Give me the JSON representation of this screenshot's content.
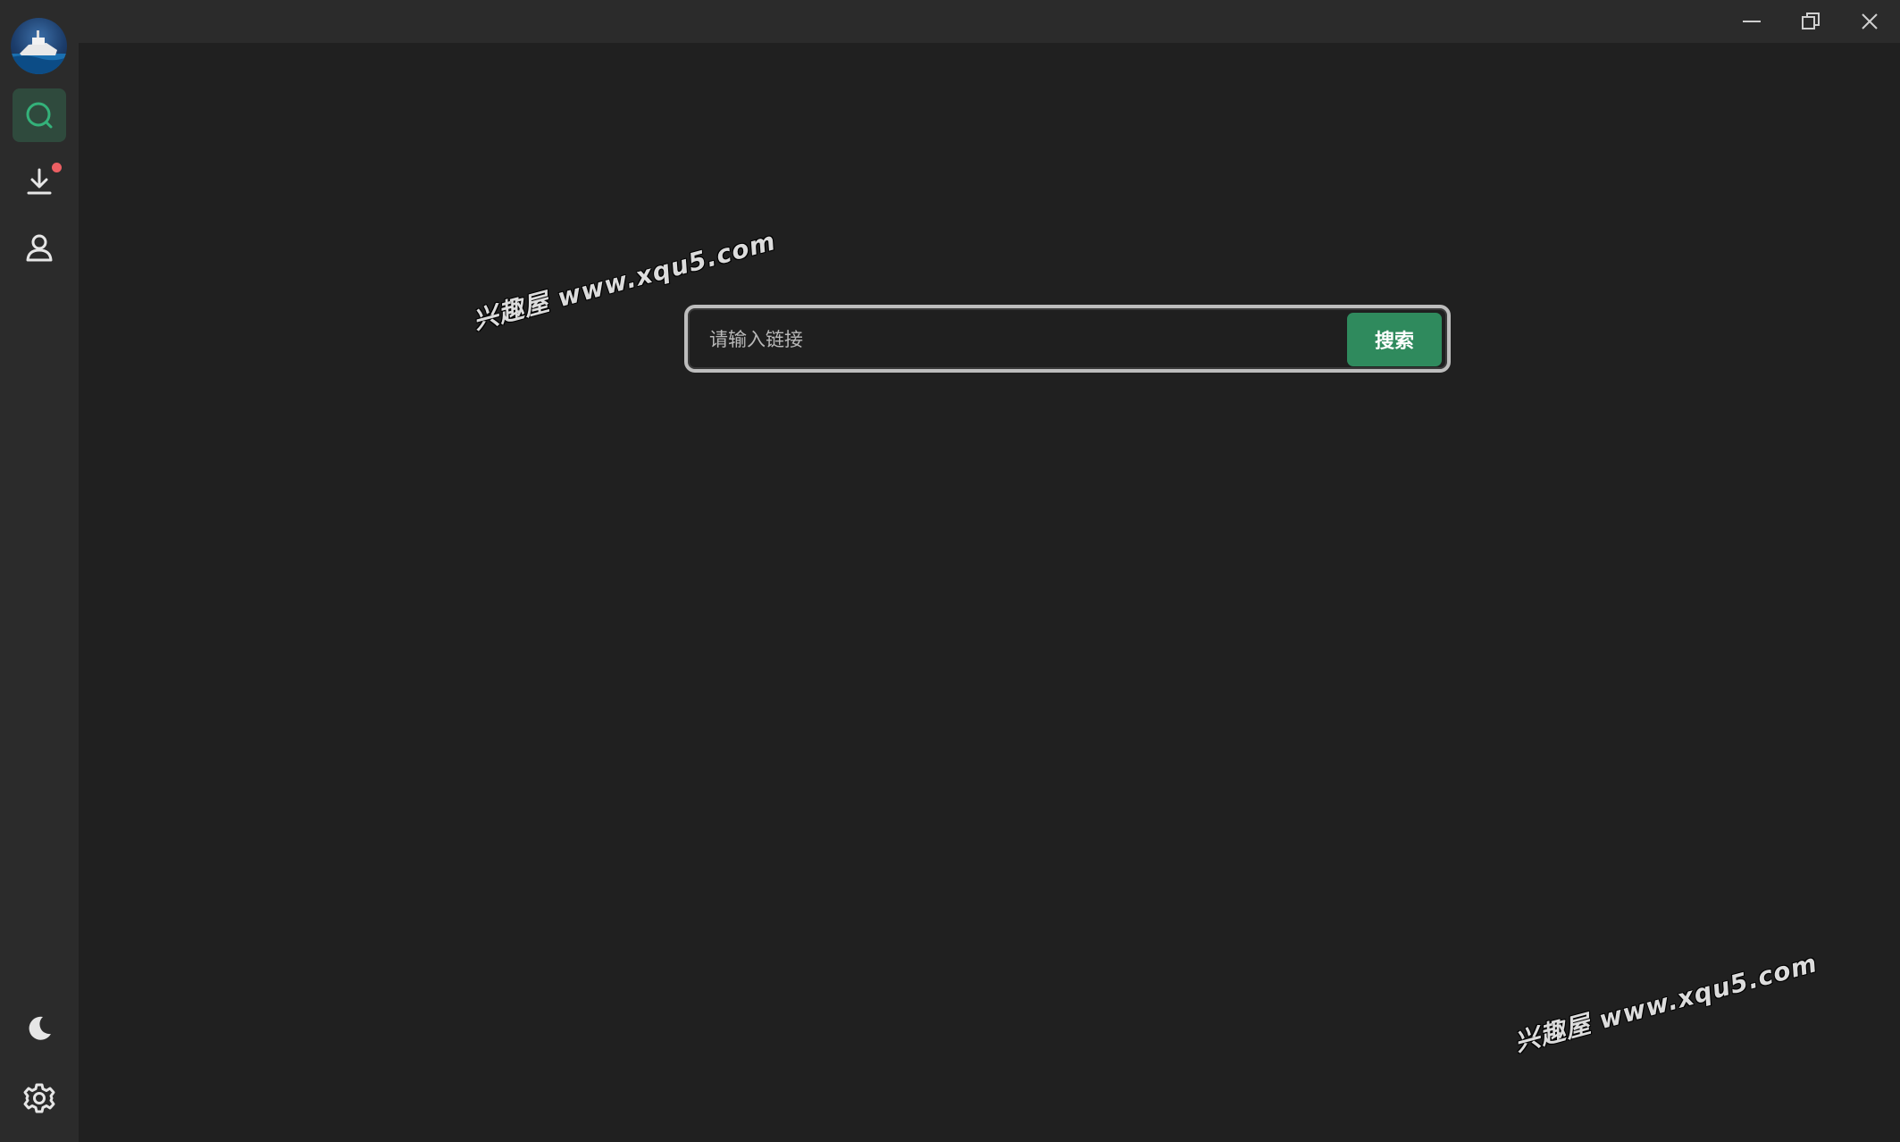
{
  "window": {
    "controls": {
      "minimize_icon": "minimize-icon",
      "maximize_icon": "restore-icon",
      "close_icon": "close-icon"
    }
  },
  "sidebar": {
    "items": [
      {
        "icon": "search-icon",
        "active": true
      },
      {
        "icon": "download-icon",
        "has_notification": true
      },
      {
        "icon": "user-icon"
      }
    ],
    "bottom_items": [
      {
        "icon": "moon-icon"
      },
      {
        "icon": "gear-icon"
      }
    ]
  },
  "search": {
    "placeholder": "请输入链接",
    "value": "",
    "button_label": "搜索"
  },
  "watermarks": [
    {
      "text": "兴趣屋 www.xqu5.com"
    },
    {
      "text": "兴趣屋 www.xqu5.com"
    }
  ],
  "colors": {
    "accent": "#2f8a5d",
    "sidebar_bg": "#2b2b2b",
    "main_bg": "#202020",
    "notification": "#ec5f63"
  }
}
